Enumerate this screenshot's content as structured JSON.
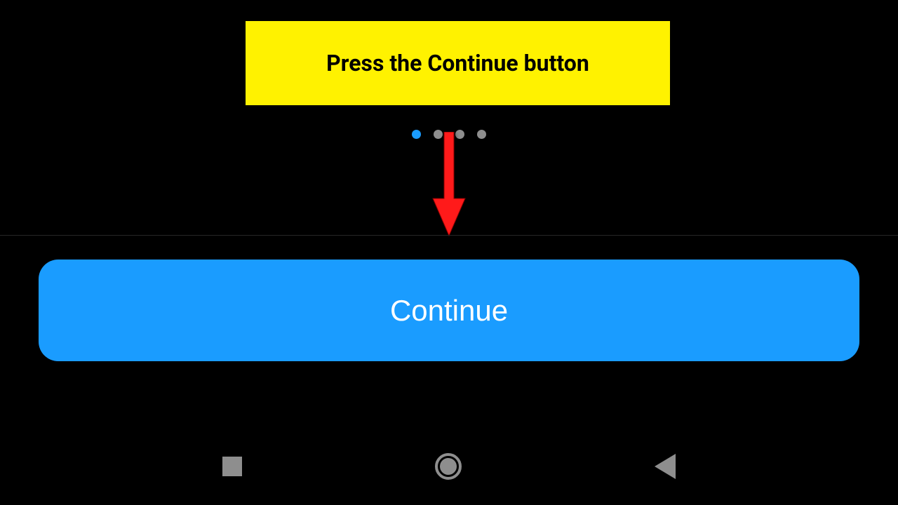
{
  "instruction": {
    "text": "Press the Continue button"
  },
  "pagination": {
    "total": 4,
    "active_index": 0
  },
  "button": {
    "continue_label": "Continue"
  },
  "colors": {
    "banner_bg": "#fff200",
    "button_bg": "#1a9cff",
    "arrow": "#ff1a1a"
  }
}
